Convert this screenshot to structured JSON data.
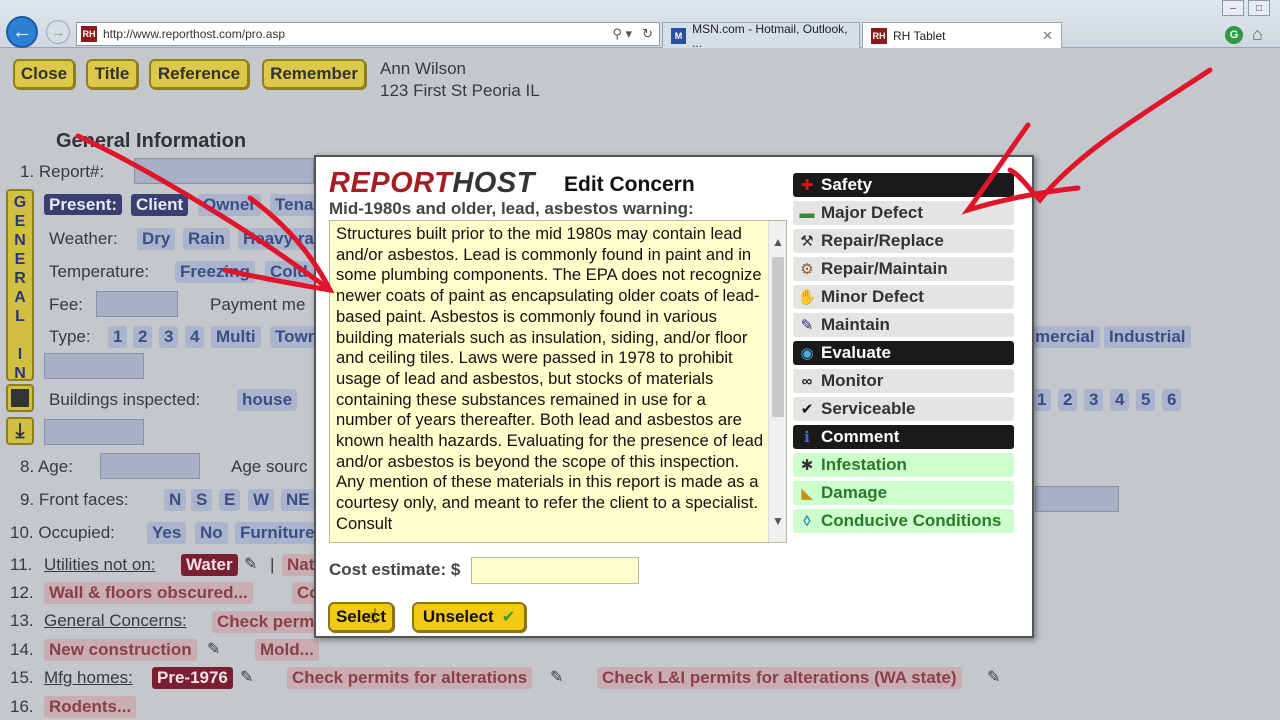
{
  "browser": {
    "url_prefix": "http://www.reporthost.com",
    "url_path": "/pro.asp",
    "tabs": [
      {
        "label": "MSN.com - Hotmail, Outlook, ...",
        "favicon": "msn-icon"
      },
      {
        "label": "RH Tablet",
        "favicon": "rh-icon",
        "active": true
      }
    ],
    "search_glyph": "⚲ ▾",
    "refresh_glyph": "↻",
    "home_glyph": "⌂"
  },
  "toolbar": {
    "close_label": "Close",
    "title_label": "Title",
    "reference_label": "Reference",
    "remember_label": "Remember"
  },
  "client": {
    "name": "Ann Wilson",
    "address": "123 First St Peoria IL"
  },
  "form": {
    "section_title": "General Information",
    "side_tab_letters": [
      "G",
      "E",
      "N",
      "E",
      "R",
      "A",
      "L",
      "",
      "I",
      "N"
    ],
    "rows": {
      "report_label": "1.   Report#:",
      "present_label": "Present:",
      "present_options": [
        "Client",
        "Owner",
        "Tena"
      ],
      "weather_label": "Weather:",
      "weather_options": [
        "Dry",
        "Rain",
        "Heavy ra"
      ],
      "temperature_label": "Temperature:",
      "temperature_options": [
        "Freezing",
        "Cold"
      ],
      "fee_label": "Fee:",
      "payment_label": "Payment me",
      "type_label": "Type:",
      "type_options": [
        "1",
        "2",
        "3",
        "4",
        "Multi",
        "Town"
      ],
      "type_options_right": [
        "mercial",
        "Industrial"
      ],
      "buildings_label": "Buildings inspected:",
      "buildings_options": [
        "house"
      ],
      "buildings_numbers": [
        "1",
        "2",
        "3",
        "4",
        "5",
        "6"
      ],
      "age_label": "8.   Age:",
      "age_source_label": "Age sourc",
      "front_label": "9.   Front faces:",
      "front_options": [
        "N",
        "S",
        "E",
        "W",
        "NE"
      ],
      "occupied_label": "10.  Occupied:",
      "occupied_options": [
        "Yes",
        "No",
        "Furniture"
      ],
      "row11_num": "11.",
      "utilities_label": "Utilities not on:",
      "utilities_options": [
        "Water",
        "Nat"
      ],
      "utilities_sep": "|",
      "row12_num": "12.",
      "wall_floors": "Wall & floors obscured...",
      "row12_right": "Co",
      "row13_num": "13.",
      "general_concerns_label": "General Concerns:",
      "general_concerns_options": [
        "Check perm"
      ],
      "row14_num": "14.",
      "new_construction": "New construction",
      "mold": "Mold...",
      "row15_num": "15.",
      "mfg_label": "Mfg homes:",
      "mfg_options": [
        "Pre-1976",
        "Check permits for alterations",
        "Check L&I permits for alterations (WA state)"
      ],
      "row16_num": "16.",
      "rodents": "Rodents..."
    }
  },
  "modal": {
    "logo_part1": "REPORT",
    "logo_part2": "HOST",
    "title": "Edit Concern",
    "concern_name": "Mid-1980s and older, lead, asbestos warning:",
    "concern_text": "Structures built prior to the mid 1980s may contain lead and/or asbestos. Lead is commonly found in paint and in some plumbing components. The EPA does not recognize newer coats of paint as encapsulating older coats of lead-based paint. Asbestos is commonly found in various building materials such as insulation, siding, and/or floor and ceiling tiles. Laws were passed in 1978 to prohibit usage of lead and asbestos, but stocks of materials containing these substances remained in use for a number of years thereafter. Both lead and asbestos are known health hazards. Evaluating for the presence of lead and/or asbestos is beyond the scope of this inspection. Any mention of these materials in this report is made as a courtesy only, and meant to refer the client to a specialist. Consult",
    "cost_label": "Cost estimate:",
    "cost_currency": "$",
    "cost_value": "",
    "select_label": "Select",
    "unselect_label": "Unselect",
    "categories": [
      {
        "label": "Safety",
        "icon": "red-cross-icon",
        "glyph": "✚",
        "style": "black",
        "glyph_color": "#e01515"
      },
      {
        "label": "Major Defect",
        "icon": "money-icon",
        "glyph": "▬",
        "style": "gray",
        "glyph_color": "#3a8a3a"
      },
      {
        "label": "Repair/Replace",
        "icon": "hammer-icon",
        "glyph": "⚒",
        "style": "gray",
        "glyph_color": "#333333"
      },
      {
        "label": "Repair/Maintain",
        "icon": "wrench-icon",
        "glyph": "⚙",
        "style": "gray",
        "glyph_color": "#8a5a2a"
      },
      {
        "label": "Minor Defect",
        "icon": "bandage-icon",
        "glyph": "✋",
        "style": "gray",
        "glyph_color": "#b03050"
      },
      {
        "label": "Maintain",
        "icon": "tools-icon",
        "glyph": "✎",
        "style": "gray",
        "glyph_color": "#222266"
      },
      {
        "label": "Evaluate",
        "icon": "magnifier-icon",
        "glyph": "◉",
        "style": "black",
        "glyph_color": "#4ab0e0"
      },
      {
        "label": "Monitor",
        "icon": "binoculars-icon",
        "glyph": "∞",
        "style": "gray",
        "glyph_color": "#222222"
      },
      {
        "label": "Serviceable",
        "icon": "checkmark-icon",
        "glyph": "✔",
        "style": "gray",
        "glyph_color": "#111111"
      },
      {
        "label": "Comment",
        "icon": "info-icon",
        "glyph": "ℹ",
        "style": "black",
        "glyph_color": "#3a6ae0"
      },
      {
        "label": "Infestation",
        "icon": "bug-icon",
        "glyph": "✱",
        "style": "green",
        "glyph_color": "#333333"
      },
      {
        "label": "Damage",
        "icon": "damage-icon",
        "glyph": "◣",
        "style": "green",
        "glyph_color": "#c8901a"
      },
      {
        "label": "Conducive Conditions",
        "icon": "droplet-icon",
        "glyph": "◊",
        "style": "green",
        "glyph_color": "#2a8ab0"
      }
    ]
  },
  "colors": {
    "annotation_red": "#e0142a",
    "modal_button_yellow": "#f2c913",
    "page_button_yellow": "#dcc84a",
    "selected_option": "#3a3f70",
    "category_green": "#ccffcc"
  }
}
